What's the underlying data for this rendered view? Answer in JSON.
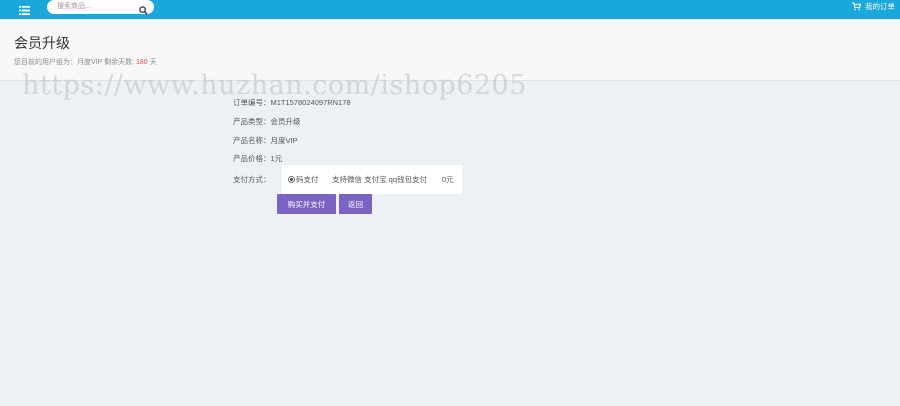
{
  "topbar": {
    "menu_icon": "menu-icon",
    "search_placeholder": "搜索商品...",
    "search_icon": "search-icon",
    "orders_icon": "cart-icon",
    "orders_label": "我的订单",
    "color": "#1aa7d9"
  },
  "header": {
    "title": "会员升级",
    "subtitle_prefix": "您目前的用户组为：月度VIP 剩余天数: ",
    "remaining_days": "180",
    "subtitle_suffix": " 天"
  },
  "watermark": "https://www.huzhan.com/ishop6205",
  "order": {
    "order_no_label": "订单编号：",
    "order_no": "M1T1578024097RN178",
    "product_type_label": "产品类型：",
    "product_type": "会员升级",
    "product_name_label": "产品名称：",
    "product_name": "月度VIP",
    "price_label": "产品价格：",
    "price": "1元",
    "payment_label": "支付方式：",
    "payment_option": "码支付",
    "payment_desc": "支持微信 支付宝 qq钱包支付",
    "payment_fee": "0元"
  },
  "buttons": {
    "buy": "购买并支付",
    "back": "返回",
    "color": "#7b63c4"
  }
}
